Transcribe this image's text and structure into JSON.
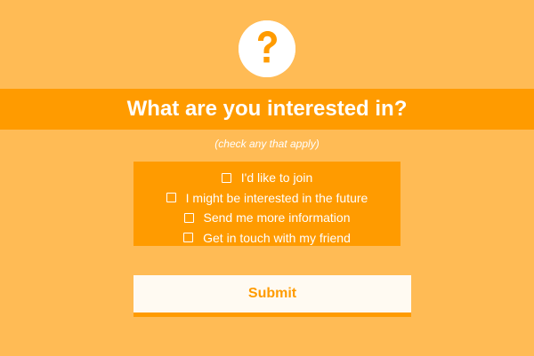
{
  "icon": "question-circle-icon",
  "colors": {
    "background": "#ffbb55",
    "accent": "#ff9b00",
    "text_light": "#ffffff",
    "button_bg": "#fffaf2"
  },
  "title": "What are you interested in?",
  "hint": "(check any that apply)",
  "options": [
    {
      "label": "I'd like to join",
      "checked": false
    },
    {
      "label": "I might be interested in the future",
      "checked": false
    },
    {
      "label": "Send me more information",
      "checked": false
    },
    {
      "label": "Get in touch with my friend",
      "checked": false
    }
  ],
  "submit_label": "Submit"
}
